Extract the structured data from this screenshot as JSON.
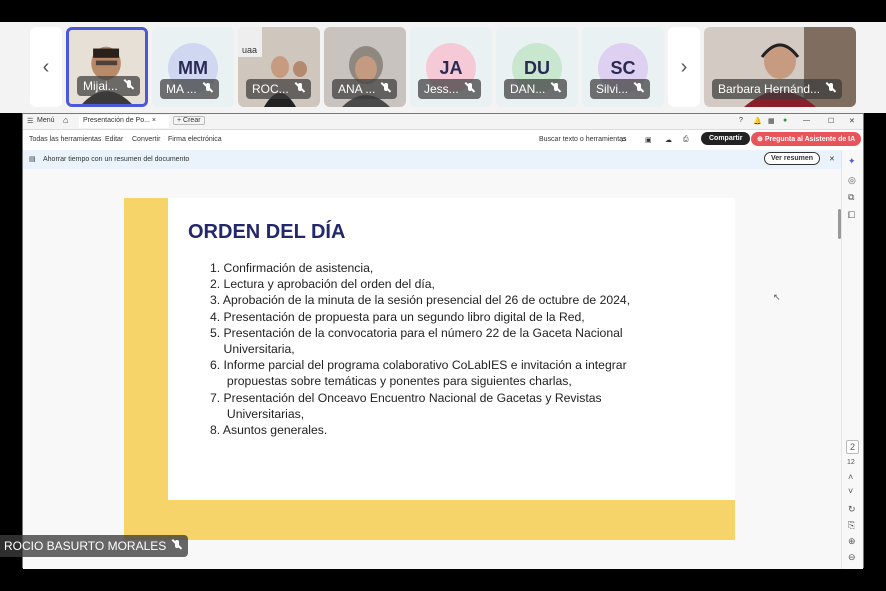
{
  "participants": [
    {
      "label": "Mijai...",
      "type": "photo"
    },
    {
      "label": "MA ...",
      "initials": "MM",
      "color": "#cfd8f0"
    },
    {
      "label": "ROC...",
      "type": "photo"
    },
    {
      "label": "ANA ...",
      "type": "photo"
    },
    {
      "label": "Jess...",
      "initials": "JA",
      "color": "#f6c9d6"
    },
    {
      "label": "DAN...",
      "initials": "DU",
      "color": "#c9e6cf"
    },
    {
      "label": "Silvi...",
      "initials": "SC",
      "color": "#ddd0f1"
    },
    {
      "label": "Barbara Hernánd...",
      "type": "photo"
    }
  ],
  "self_name": "ROCIO BASURTO MORALES",
  "app": {
    "menu": "Menú",
    "tab": "Presentación de Po...",
    "new_tab": "Crear",
    "toolbar": [
      "Todas las herramientas",
      "Editar",
      "Convertir",
      "Firma electrónica"
    ],
    "search": "Buscar texto o herramientas",
    "share": "Compartir",
    "ai": "Pregunta al Asistente de IA",
    "banner": "Ahorrar tiempo con un resumen del documento",
    "summary_btn": "Ver resumen",
    "page_current": "2",
    "page_total": "12"
  },
  "slide": {
    "title": "ORDEN DEL DÍA",
    "lines": [
      "1. Confirmación de asistencia,",
      "2. Lectura y aprobación del orden del día,",
      "3. Aprobación de la minuta de la sesión presencial del 26 de octubre de 2024,",
      "4. Presentación de propuesta para un segundo libro digital de la Red,",
      "5. Presentación de la convocatoria para el número 22 de la Gaceta Nacional",
      "    Universitaria,",
      "6. Informe parcial del programa colaborativo CoLabIES e invitación a integrar",
      "     propuestas sobre temáticas y ponentes para siguientes charlas,",
      "7. Presentación del Onceavo Encuentro Nacional de Gacetas y Revistas",
      "     Universitarias,",
      "8. Asuntos generales."
    ]
  }
}
